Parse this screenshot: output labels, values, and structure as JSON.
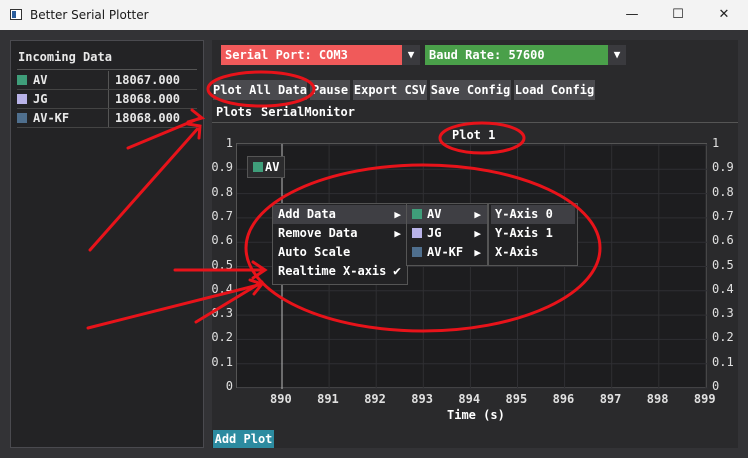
{
  "window": {
    "title": "Better Serial Plotter",
    "minimize": "—",
    "maximize": "☐",
    "close": "✕"
  },
  "incoming": {
    "title": "Incoming Data",
    "rows": [
      {
        "name": "AV",
        "value": "18067.000",
        "color": "#3f9e7a"
      },
      {
        "name": "JG",
        "value": "18068.000",
        "color": "#b9b3e8"
      },
      {
        "name": "AV-KF",
        "value": "18068.000",
        "color": "#4f6f8e"
      }
    ]
  },
  "toolbar": {
    "serial_port": "Serial Port: COM3",
    "baud_rate": "Baud Rate: 57600",
    "serial_color": "#f05a5a",
    "baud_color": "#4aa04a",
    "plot_all": "Plot All Data",
    "pause": "Pause",
    "export_csv": "Export CSV",
    "save_config": "Save Config",
    "load_config": "Load Config"
  },
  "tabs": {
    "plots": "Plots",
    "serial_monitor": "SerialMonitor"
  },
  "plot": {
    "title": "Plot 1",
    "legend_entry": "AV",
    "xlabel": "Time (s)",
    "y_ticks": [
      "1",
      "0.9",
      "0.8",
      "0.7",
      "0.6",
      "0.5",
      "0.4",
      "0.3",
      "0.2",
      "0.1",
      "0"
    ],
    "x_ticks": [
      "890",
      "891",
      "892",
      "893",
      "894",
      "895",
      "896",
      "897",
      "898",
      "899"
    ]
  },
  "context_menu": {
    "items": [
      "Add Data",
      "Remove Data",
      "Auto Scale",
      "Realtime X-axis"
    ],
    "checkmark": "✔",
    "arrow": "▶"
  },
  "series_menu": {
    "items": [
      "AV",
      "JG",
      "AV-KF"
    ]
  },
  "axis_menu": {
    "items": [
      "Y-Axis 0",
      "Y-Axis 1",
      "X-Axis"
    ]
  },
  "add_plot": "Add Plot",
  "annotation_color": "#e8131a"
}
